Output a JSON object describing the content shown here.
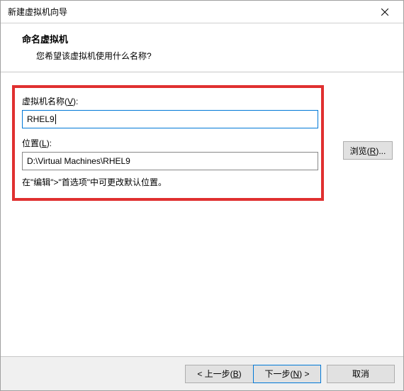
{
  "window": {
    "title": "新建虚拟机向导"
  },
  "header": {
    "title": "命名虚拟机",
    "subtitle": "您希望该虚拟机使用什么名称?"
  },
  "form": {
    "name_label_pre": "虚拟机名称(",
    "name_label_key": "V",
    "name_label_post": "):",
    "name_value": "RHEL9",
    "location_label_pre": "位置(",
    "location_label_key": "L",
    "location_label_post": "):",
    "location_value": "D:\\Virtual Machines\\RHEL9",
    "hint": "在\"编辑\">\"首选项\"中可更改默认位置。"
  },
  "buttons": {
    "browse_pre": "浏览(",
    "browse_key": "R",
    "browse_post": ")...",
    "back_pre": "< 上一步(",
    "back_key": "B",
    "back_post": ")",
    "next_pre": "下一步(",
    "next_key": "N",
    "next_post": ") >",
    "cancel": "取消"
  }
}
